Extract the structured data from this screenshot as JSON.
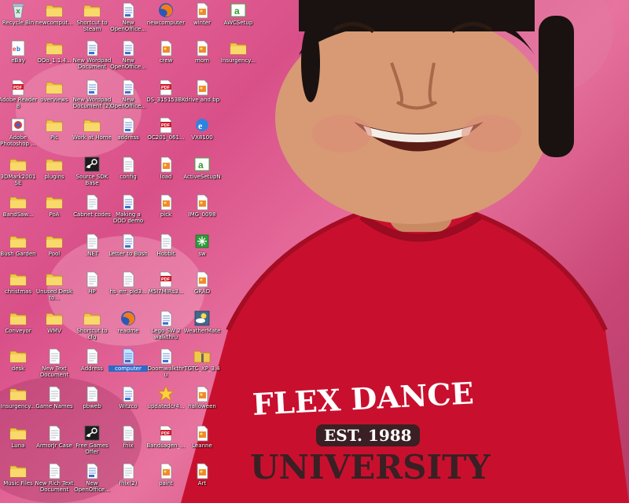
{
  "desktop": {
    "selected_icon": "computer",
    "columns": [
      [
        {
          "label": "Recycle Bin",
          "icon": "recycle-bin-icon"
        },
        {
          "label": "eBay",
          "icon": "ebay-icon"
        },
        {
          "label": "Adobe Reader 8",
          "icon": "pdf-icon"
        },
        {
          "label": "Adobe Photoshop ...",
          "icon": "app-icon"
        },
        {
          "label": "3DMark2001 SE",
          "icon": "folder-icon"
        },
        {
          "label": "BandSaw...",
          "icon": "folder-icon"
        },
        {
          "label": "Bush Garden",
          "icon": "folder-icon"
        },
        {
          "label": "christmas",
          "icon": "folder-icon"
        },
        {
          "label": "Conveyor",
          "icon": "folder-icon"
        },
        {
          "label": "desk",
          "icon": "folder-icon"
        },
        {
          "label": "Insurgency...",
          "icon": "folder-icon"
        },
        {
          "label": "Luna",
          "icon": "folder-icon"
        },
        {
          "label": "Music Files",
          "icon": "folder-icon"
        }
      ],
      [
        {
          "label": "newcomput...",
          "icon": "folder-icon"
        },
        {
          "label": "OOo_1.1.4...",
          "icon": "folder-icon"
        },
        {
          "label": "overviews",
          "icon": "folder-icon"
        },
        {
          "label": "Pic",
          "icon": "folder-icon"
        },
        {
          "label": "plugins",
          "icon": "folder-icon"
        },
        {
          "label": "PoA",
          "icon": "folder-icon"
        },
        {
          "label": "Pool",
          "icon": "folder-icon"
        },
        {
          "label": "Unused Desk to...",
          "icon": "folder-icon"
        },
        {
          "label": "WMV",
          "icon": "folder-icon"
        },
        {
          "label": "New Text Document",
          "icon": "text-file-icon"
        },
        {
          "label": "Game Names",
          "icon": "text-file-icon"
        },
        {
          "label": "ArmorJr Case",
          "icon": "text-file-icon"
        },
        {
          "label": "New Rich Text Document",
          "icon": "text-file-icon"
        }
      ],
      [
        {
          "label": "Shortcut to Steam",
          "icon": "folder-icon"
        },
        {
          "label": "New Wordpad Document",
          "icon": "document-icon"
        },
        {
          "label": "New Wordpad Document (2)",
          "icon": "document-icon"
        },
        {
          "label": "Work at Home",
          "icon": "folder-icon"
        },
        {
          "label": "Source SDK Base",
          "icon": "steam-icon"
        },
        {
          "label": "Cabnet codes",
          "icon": "text-file-icon"
        },
        {
          "label": ".NET",
          "icon": "text-file-icon"
        },
        {
          "label": "HP",
          "icon": "text-file-icon"
        },
        {
          "label": "Shortcut to cfg",
          "icon": "folder-icon"
        },
        {
          "label": "Address",
          "icon": "text-file-icon"
        },
        {
          "label": "pbweb",
          "icon": "text-file-icon"
        },
        {
          "label": "Free Games Offer",
          "icon": "steam-icon"
        },
        {
          "label": "New OpenOffice...",
          "icon": "document-icon"
        }
      ],
      [
        {
          "label": "New OpenOffice...",
          "icon": "document-icon"
        },
        {
          "label": "New OpenOffice...",
          "icon": "document-icon"
        },
        {
          "label": "New OpenOffice...",
          "icon": "document-icon"
        },
        {
          "label": "address",
          "icon": "document-icon"
        },
        {
          "label": "config",
          "icon": "text-file-icon"
        },
        {
          "label": "Making a DOD demo",
          "icon": "document-icon"
        },
        {
          "label": "Letter to Bush",
          "icon": "document-icon"
        },
        {
          "label": "hs_err_pid3...",
          "icon": "text-file-icon"
        },
        {
          "label": "readme",
          "icon": "firefox-icon"
        },
        {
          "label": "computer",
          "icon": "document-icon"
        },
        {
          "label": "Witzco",
          "icon": "document-icon"
        },
        {
          "label": "fhix",
          "icon": "text-file-icon"
        },
        {
          "label": "fhix(2)",
          "icon": "text-file-icon"
        }
      ],
      [
        {
          "label": "newcomputer",
          "icon": "firefox-icon"
        },
        {
          "label": "crew",
          "icon": "image-icon"
        },
        {
          "label": "DS_315153BK",
          "icon": "pdf-icon"
        },
        {
          "label": "OC201_061...",
          "icon": "pdf-icon"
        },
        {
          "label": "load",
          "icon": "image-icon"
        },
        {
          "label": "pick",
          "icon": "image-icon"
        },
        {
          "label": "Hobbit",
          "icon": "text-file-icon"
        },
        {
          "label": "M5I7MIRs3...",
          "icon": "pdf-icon"
        },
        {
          "label": "Lego SW 2 walkthru",
          "icon": "document-icon"
        },
        {
          "label": "Doomwalkthru",
          "icon": "document-icon"
        },
        {
          "label": "updatedcr4...",
          "icon": "star-icon"
        },
        {
          "label": "Bandsagen_...",
          "icon": "pdf-icon"
        },
        {
          "label": "paint",
          "icon": "image-icon"
        }
      ],
      [
        {
          "label": "winter",
          "icon": "image-icon"
        },
        {
          "label": "mom",
          "icon": "image-icon"
        },
        {
          "label": "drive and bp",
          "icon": "image-icon"
        },
        {
          "label": "VX8100",
          "icon": "ie-icon"
        },
        {
          "label": "ActiveSetupN",
          "icon": "setup-icon"
        },
        {
          "label": "IMG_0098",
          "icon": "image-icon"
        },
        {
          "label": "sw",
          "icon": "green-app-icon"
        },
        {
          "label": "GRAD",
          "icon": "image-icon"
        },
        {
          "label": "WeatherMate",
          "icon": "weather-icon"
        },
        {
          "label": "TGTC_XP_3.4",
          "icon": "zip-folder-icon"
        },
        {
          "label": "halloween",
          "icon": "image-icon"
        },
        {
          "label": "Leanne",
          "icon": "image-icon"
        },
        {
          "label": "Art",
          "icon": "image-icon"
        }
      ],
      [
        {
          "label": "AWCSetup",
          "icon": "setup-icon"
        },
        {
          "label": "Insurgency...",
          "icon": "folder-icon"
        }
      ]
    ],
    "shirt": {
      "line1": "FLEX DANCE",
      "line2": "EST. 1988",
      "line3": "UNIVERSITY"
    }
  }
}
